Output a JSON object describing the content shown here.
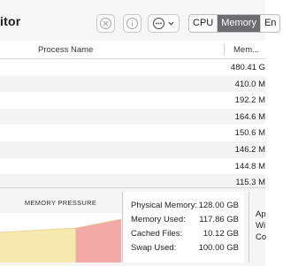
{
  "toolbar": {
    "title": "itor",
    "tabs": [
      {
        "label": "CPU",
        "selected": false
      },
      {
        "label": "Memory",
        "selected": true
      },
      {
        "label": "En",
        "selected": false
      }
    ]
  },
  "table": {
    "columns": {
      "name": "Process Name",
      "memory": "Mem..."
    },
    "rows": [
      {
        "memory": "480.41 G"
      },
      {
        "memory": "410.0 M"
      },
      {
        "memory": "192.2 M"
      },
      {
        "memory": "164.6 M"
      },
      {
        "memory": "150.6 M"
      },
      {
        "memory": "146.2 M"
      },
      {
        "memory": "144.8 M"
      },
      {
        "memory": "115.3 M"
      }
    ]
  },
  "memory_panel": {
    "pressure_title": "MEMORY PRESSURE",
    "stats": [
      {
        "label": "Physical Memory:",
        "value": "128.00 GB"
      },
      {
        "label": "Memory Used:",
        "value": "117.86 GB"
      },
      {
        "label": "Cached Files:",
        "value": "10.12 GB"
      },
      {
        "label": "Swap Used:",
        "value": "100.00 GB"
      }
    ],
    "legend": [
      "Ap",
      "Wi",
      "Co"
    ]
  },
  "colors": {
    "selected_tab": "#6d6d70",
    "pressure_yellow": "#f7e9b0",
    "pressure_red": "#f2aaa6"
  }
}
